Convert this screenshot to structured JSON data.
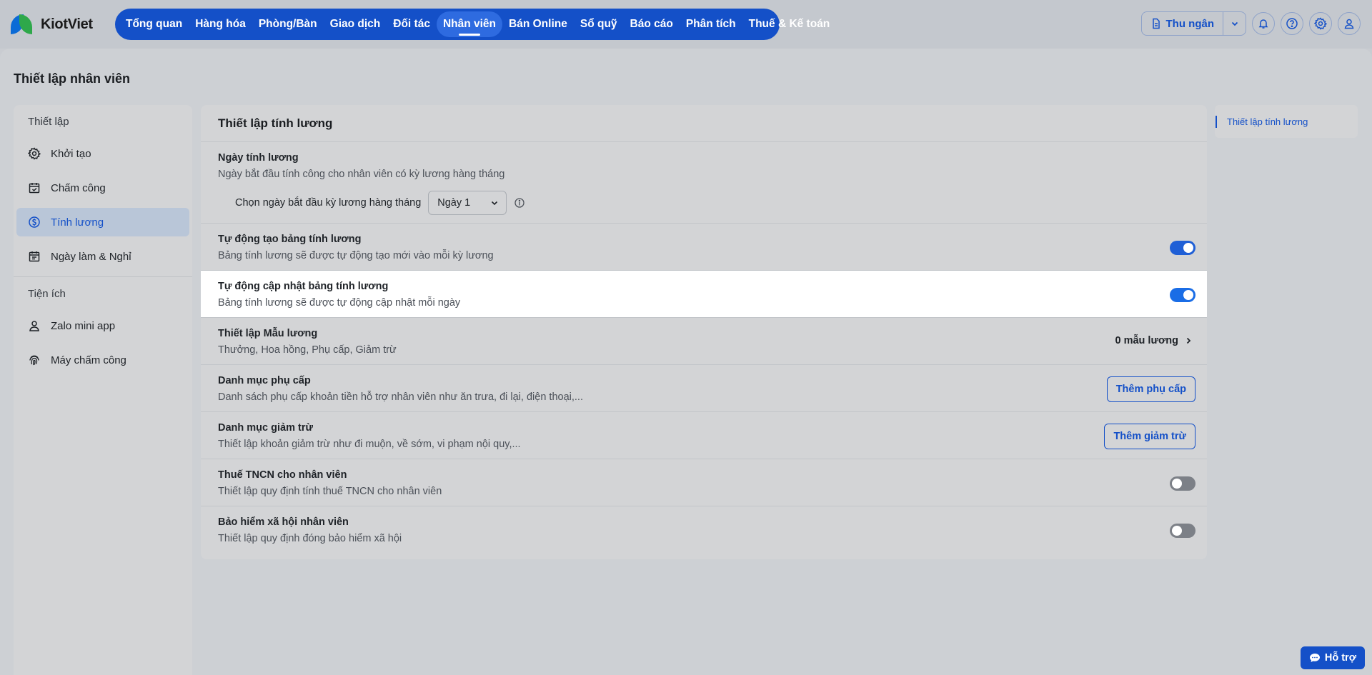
{
  "brand": {
    "name": "KiotViet"
  },
  "nav": {
    "items": [
      {
        "label": "Tổng quan"
      },
      {
        "label": "Hàng hóa"
      },
      {
        "label": "Phòng/Bàn"
      },
      {
        "label": "Giao dịch"
      },
      {
        "label": "Đối tác"
      },
      {
        "label": "Nhân viên",
        "active": true
      },
      {
        "label": "Bán Online"
      },
      {
        "label": "Sổ quỹ"
      },
      {
        "label": "Báo cáo"
      },
      {
        "label": "Phân tích"
      },
      {
        "label": "Thuế & Kế toán"
      }
    ]
  },
  "topright": {
    "cashier_label": "Thu ngân",
    "icons": [
      "bell-icon",
      "help-icon",
      "gear-icon",
      "user-icon"
    ]
  },
  "page": {
    "title": "Thiết lập nhân viên"
  },
  "sidebar": {
    "section_setup": "Thiết lập",
    "setup_items": [
      {
        "label": "Khởi tạo",
        "icon": "gear-icon"
      },
      {
        "label": "Chấm công",
        "icon": "calendar-check-icon"
      },
      {
        "label": "Tính lương",
        "icon": "dollar-circle-icon",
        "active": true
      },
      {
        "label": "Ngày làm & Nghỉ",
        "icon": "calendar-icon"
      }
    ],
    "section_utility": "Tiện ích",
    "utility_items": [
      {
        "label": "Zalo mini app",
        "icon": "person-icon"
      },
      {
        "label": "Máy chấm công",
        "icon": "fingerprint-icon"
      }
    ]
  },
  "panel": {
    "title": "Thiết lập tính lương",
    "rows": {
      "payday": {
        "title": "Ngày tính lương",
        "desc": "Ngày bắt đầu tính công cho nhân viên có kỳ lương hàng tháng",
        "select_label": "Chọn ngày bắt đầu kỳ lương hàng tháng",
        "select_value": "Ngày 1"
      },
      "auto_create": {
        "title": "Tự động tạo bảng tính lương",
        "desc": "Bảng tính lương sẽ được tự động tạo mới vào mỗi kỳ lương",
        "enabled": true
      },
      "auto_update": {
        "title": "Tự động cập nhật bảng tính lương",
        "desc": "Bảng tính lương sẽ được tự động cập nhật mỗi ngày",
        "enabled": true
      },
      "templates": {
        "title": "Thiết lập Mẫu lương",
        "desc": "Thưởng, Hoa hồng, Phụ cấp, Giảm trừ",
        "count_label": "0 mẫu lương"
      },
      "allowance": {
        "title": "Danh mục phụ cấp",
        "desc": "Danh sách phụ cấp khoản tiền hỗ trợ nhân viên như ăn trưa, đi lại, điện thoại,...",
        "button": "Thêm phụ cấp"
      },
      "deduction": {
        "title": "Danh mục giảm trừ",
        "desc": "Thiết lập khoản giảm trừ như đi muộn, về sớm, vi phạm nội quy,...",
        "button": "Thêm giảm trừ"
      },
      "tax": {
        "title": "Thuế TNCN cho nhân viên",
        "desc": "Thiết lập quy định tính thuế TNCN cho nhân viên",
        "enabled": false
      },
      "insurance": {
        "title": "Bảo hiểm xã hội nhân viên",
        "desc": "Thiết lập quy định đóng bảo hiểm xã hội",
        "enabled": false
      }
    }
  },
  "outline": {
    "link": "Thiết lập tính lương"
  },
  "support": {
    "label": "Hỗ trợ"
  },
  "colors": {
    "brand_blue": "#1450c8",
    "toggle_on": "#1f5fd6",
    "toggle_off": "#7c8087"
  }
}
